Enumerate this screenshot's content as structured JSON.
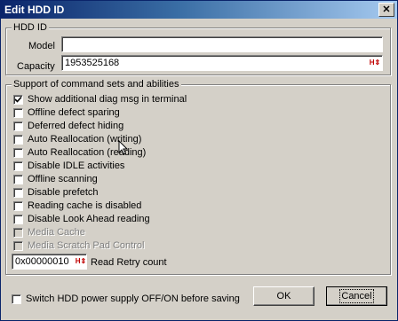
{
  "window": {
    "title": "Edit HDD ID",
    "close_glyph": "✕"
  },
  "hdd_id": {
    "legend": "HDD ID",
    "model_label": "Model",
    "model_value": "",
    "capacity_label": "Capacity",
    "capacity_value": "1953525168",
    "hex_icon": "H⇕"
  },
  "support": {
    "legend": "Support of command sets and abilities",
    "items": [
      {
        "label": "Show additional diag msg in terminal",
        "checked": true,
        "disabled": false
      },
      {
        "label": "Offline defect sparing",
        "checked": false,
        "disabled": false
      },
      {
        "label": "Deferred defect hiding",
        "checked": false,
        "disabled": false
      },
      {
        "label": "Auto Reallocation (writing)",
        "checked": false,
        "disabled": false
      },
      {
        "label": "Auto Reallocation (reading)",
        "checked": false,
        "disabled": false
      },
      {
        "label": "Disable IDLE activities",
        "checked": false,
        "disabled": false
      },
      {
        "label": "Offline scanning",
        "checked": false,
        "disabled": false
      },
      {
        "label": "Disable prefetch",
        "checked": false,
        "disabled": false
      },
      {
        "label": "Reading cache is disabled",
        "checked": false,
        "disabled": false
      },
      {
        "label": "Disable Look Ahead reading",
        "checked": false,
        "disabled": false
      },
      {
        "label": "Media Cache",
        "checked": false,
        "disabled": true
      },
      {
        "label": "Media Scratch Pad Control",
        "checked": false,
        "disabled": true
      }
    ],
    "retry_value": "0x00000010",
    "retry_label": "Read Retry count"
  },
  "footer": {
    "power_label": "Switch HDD power supply OFF/ON before saving",
    "ok_label": "OK",
    "cancel_label": "Cancel"
  }
}
